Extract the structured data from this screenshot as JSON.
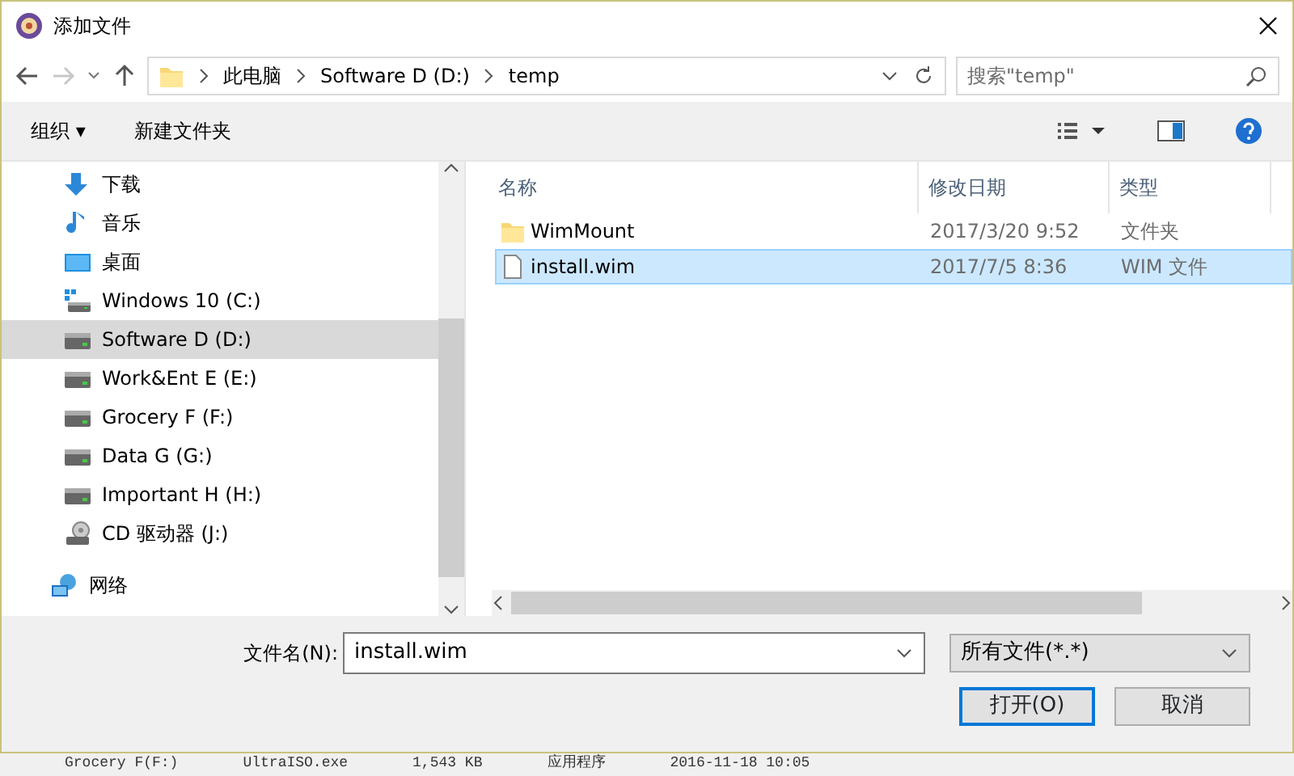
{
  "window": {
    "title": "添加文件"
  },
  "address": {
    "crumbs": [
      "此电脑",
      "Software D (D:)",
      "temp"
    ]
  },
  "search": {
    "placeholder": "搜索\"temp\""
  },
  "toolbar": {
    "organize": "组织 ▾",
    "new_folder": "新建文件夹"
  },
  "sidebar": {
    "items": [
      {
        "label": "下载",
        "kind": "download",
        "selected": false
      },
      {
        "label": "音乐",
        "kind": "music",
        "selected": false
      },
      {
        "label": "桌面",
        "kind": "desktop",
        "selected": false
      },
      {
        "label": "Windows 10 (C:)",
        "kind": "sysdrive",
        "selected": false
      },
      {
        "label": "Software D (D:)",
        "kind": "drive",
        "selected": true
      },
      {
        "label": "Work&Ent E (E:)",
        "kind": "drive",
        "selected": false
      },
      {
        "label": "Grocery F (F:)",
        "kind": "drive",
        "selected": false
      },
      {
        "label": "Data G (G:)",
        "kind": "drive",
        "selected": false
      },
      {
        "label": "Important H (H:)",
        "kind": "drive",
        "selected": false
      },
      {
        "label": "CD 驱动器 (J:)",
        "kind": "cd",
        "selected": false
      },
      {
        "label": "网络",
        "kind": "network",
        "selected": false
      }
    ]
  },
  "table": {
    "columns": [
      "名称",
      "修改日期",
      "类型"
    ],
    "rows": [
      {
        "name": "WimMount",
        "date": "2017/3/20 9:52",
        "type": "文件夹",
        "kind": "folder",
        "selected": false
      },
      {
        "name": "install.wim",
        "date": "2017/7/5 8:36",
        "type": "WIM 文件",
        "kind": "file",
        "selected": true
      }
    ]
  },
  "filename": {
    "label": "文件名(N):",
    "value": "install.wim"
  },
  "filter": {
    "value": "所有文件(*.*)"
  },
  "buttons": [
    "打开(O)",
    "取消"
  ],
  "background": {
    "cells": [
      "Grocery F(F:)",
      "UltraISO.exe",
      "1,543 KB",
      "应用程序",
      "2016-11-18 10:05"
    ]
  }
}
